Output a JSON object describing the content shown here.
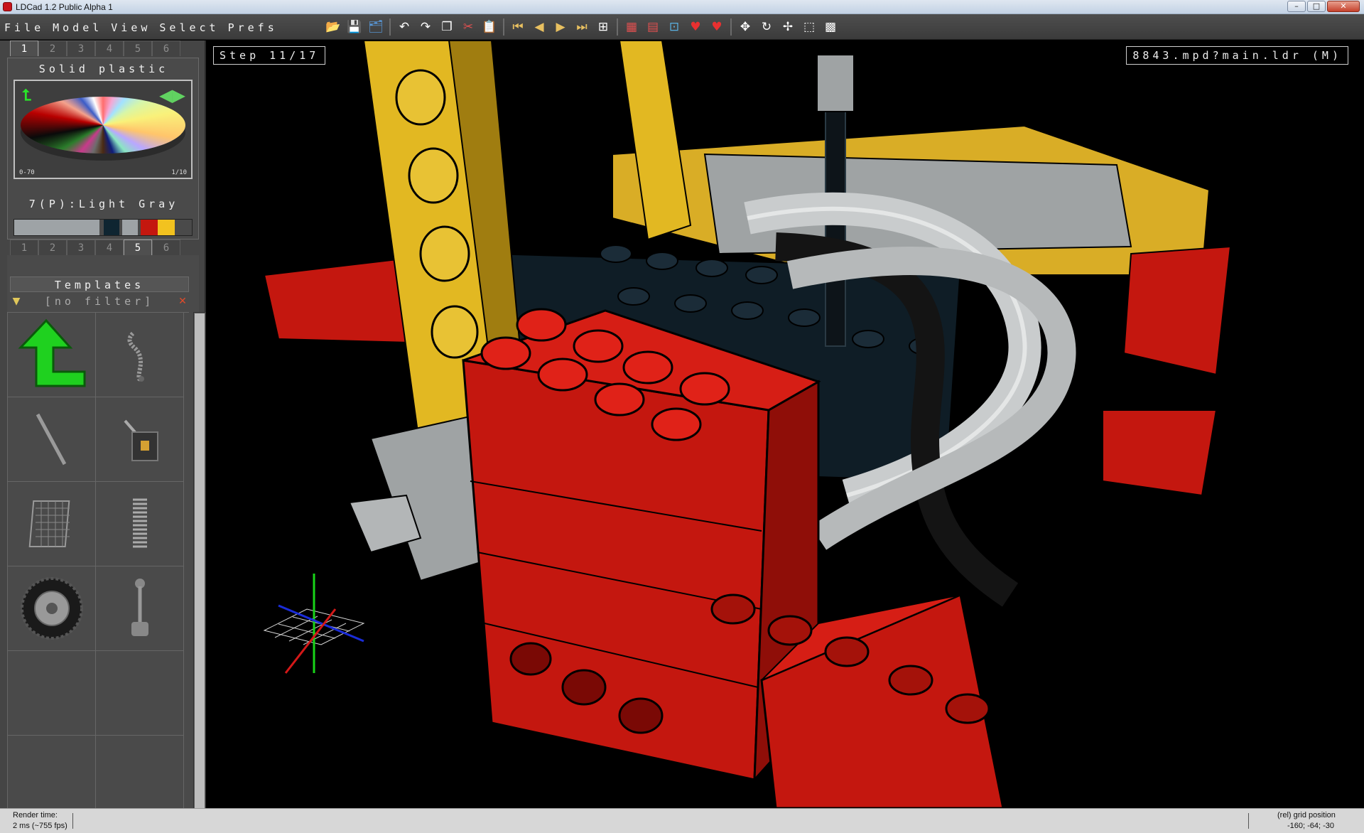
{
  "window": {
    "title": "LDCad 1.2 Public Alpha 1",
    "min_glyph": "–",
    "max_glyph": "□",
    "close_glyph": "✕"
  },
  "menu": {
    "items": [
      "File",
      "Model",
      "View",
      "Select",
      "Prefs"
    ]
  },
  "toolbar": {
    "icons": [
      {
        "name": "open-file-icon",
        "glyph": "📂"
      },
      {
        "name": "save-icon",
        "glyph": "💾"
      },
      {
        "name": "save-all-icon",
        "glyph": "🗂"
      },
      {
        "name": "undo-icon",
        "glyph": "↶"
      },
      {
        "name": "redo-icon",
        "glyph": "↷"
      },
      {
        "name": "copy-icon",
        "glyph": "❐"
      },
      {
        "name": "cut-icon",
        "glyph": "✂"
      },
      {
        "name": "paste-icon",
        "glyph": "📋"
      },
      {
        "name": "first-step-icon",
        "glyph": "⏮"
      },
      {
        "name": "prev-step-icon",
        "glyph": "◀"
      },
      {
        "name": "next-step-icon",
        "glyph": "▶"
      },
      {
        "name": "last-step-icon",
        "glyph": "⏭"
      },
      {
        "name": "add-step-icon",
        "glyph": "⊞"
      },
      {
        "name": "group-icon",
        "glyph": "▦"
      },
      {
        "name": "ungroup-icon",
        "glyph": "▤"
      },
      {
        "name": "grid-icon",
        "glyph": "⊡"
      },
      {
        "name": "favorite-icon",
        "glyph": "♥"
      },
      {
        "name": "favorite-remove-icon",
        "glyph": "♥"
      },
      {
        "name": "move-icon",
        "glyph": "✥"
      },
      {
        "name": "rotate-icon",
        "glyph": "↻"
      },
      {
        "name": "pan-icon",
        "glyph": "✢"
      },
      {
        "name": "select-mode-icon",
        "glyph": "⬚"
      },
      {
        "name": "snap-grid-icon",
        "glyph": "▩"
      }
    ]
  },
  "color_panel": {
    "tabs": [
      "1",
      "2",
      "3",
      "4",
      "5",
      "6"
    ],
    "active_tab": 0,
    "title": "Solid plastic",
    "range_left": "0-70",
    "range_right": "1/10",
    "up_glyph": "⮤",
    "nav_glyph": "◀▶",
    "selected_color": "7(P):Light Gray",
    "swatches": [
      "#9ea3a6",
      "#9ea3a6",
      "#9ea3a6",
      "#9ea3a6",
      "#9ea3a6",
      "#9ea3a6",
      "#0f2531",
      "#9ea3a6",
      "#c4170f",
      "#f2c21f"
    ]
  },
  "templates_panel": {
    "tabs": [
      "1",
      "2",
      "3",
      "4",
      "5",
      "6"
    ],
    "active_tab": 4,
    "title": "Templates",
    "filter_text": "[no filter]",
    "filter_glyph": "▼",
    "clear_glyph": "✕",
    "items": [
      "parent-up",
      "flex-hose",
      "axle-rod",
      "linear-actuator",
      "chain-mesh",
      "spring",
      "wheel-tire",
      "lever"
    ]
  },
  "viewport": {
    "step_label": "Step 11/17",
    "file_label": "8843.mpd?main.ldr (M)"
  },
  "status": {
    "render_label": "Render time:",
    "render_value": "2 ms (~755 fps)",
    "grid_label": "(rel) grid position",
    "grid_value": "-160; -64; -30"
  },
  "colors": {
    "red": "#c4170f",
    "yellow": "#e2b822",
    "dark": "#111c24",
    "gray": "#a9adae",
    "green": "#22c722"
  }
}
